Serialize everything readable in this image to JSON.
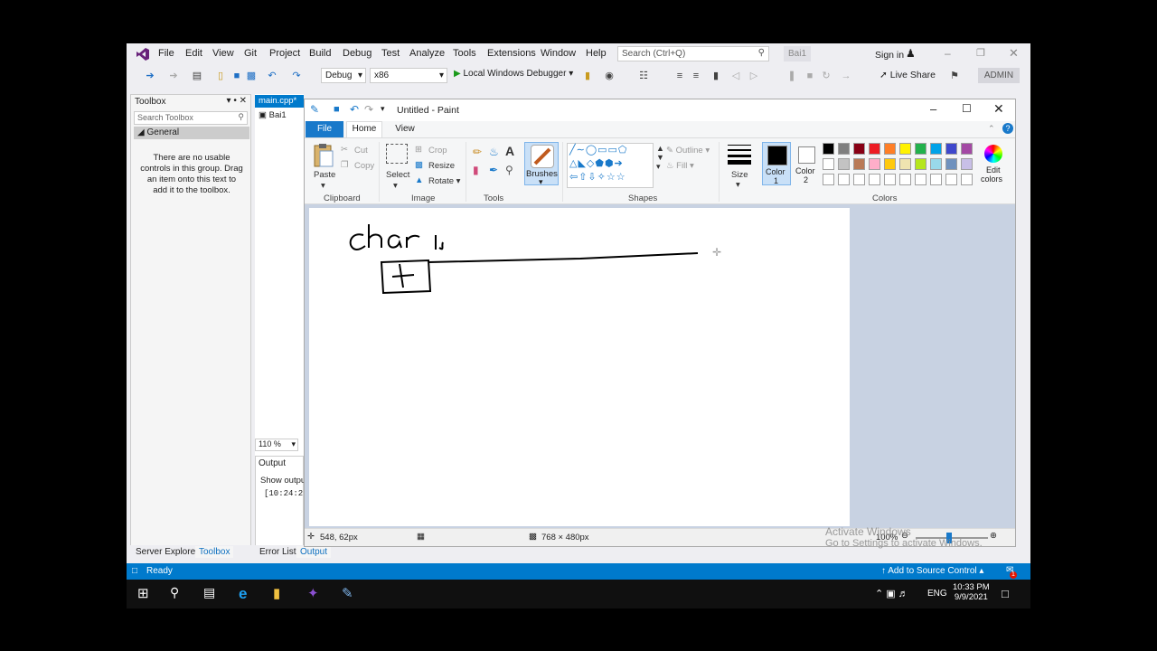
{
  "vs": {
    "menu": [
      "File",
      "Edit",
      "View",
      "Git",
      "Project",
      "Build",
      "Debug",
      "Test",
      "Analyze",
      "Tools",
      "Extensions",
      "Window",
      "Help"
    ],
    "search_placeholder": "Search (Ctrl+Q)",
    "solution_name": "Bai1",
    "sign_in": "Sign in",
    "config": "Debug",
    "platform": "x86",
    "run_label": "Local Windows Debugger",
    "live_share": "Live Share",
    "admin": "ADMIN",
    "toolbox_title": "Toolbox",
    "toolbox_search": "Search Toolbox",
    "toolbox_group": "General",
    "toolbox_empty": "There are no usable controls in this group. Drag an item onto this text to add it to the toolbox.",
    "doc_tab": "main.cpp*",
    "doc_scope": "Bai1",
    "zoom": "110 %",
    "output_title": "Output",
    "output_show": "Show output",
    "output_line": "[10:24:2",
    "bottom_left_tabs": [
      "Server Explorer",
      "Toolbox"
    ],
    "bottom_right_tabs": [
      "Error List",
      "Output"
    ],
    "status_ready": "Ready",
    "add_source_control": "Add to Source Control",
    "notif_count": "1"
  },
  "paint": {
    "title": "Untitled - Paint",
    "tabs": {
      "file": "File",
      "home": "Home",
      "view": "View"
    },
    "clipboard": {
      "paste": "Paste",
      "cut": "Cut",
      "copy": "Copy",
      "label": "Clipboard"
    },
    "image": {
      "select": "Select",
      "crop": "Crop",
      "resize": "Resize",
      "rotate": "Rotate",
      "label": "Image"
    },
    "tools_label": "Tools",
    "brushes": "Brushes",
    "shapes": {
      "outline": "Outline",
      "fill": "Fill",
      "label": "Shapes"
    },
    "size": "Size",
    "color1": [
      "Color",
      "1"
    ],
    "color2": [
      "Color",
      "2"
    ],
    "edit_colors": [
      "Edit",
      "colors"
    ],
    "colors_label": "Colors",
    "palette_row1": [
      "#000000",
      "#7f7f7f",
      "#880015",
      "#ed1c24",
      "#ff7f27",
      "#fff200",
      "#22b14c",
      "#00a2e8",
      "#3f48cc",
      "#a349a4"
    ],
    "palette_row2": [
      "#ffffff",
      "#c3c3c3",
      "#b97a57",
      "#ffaec9",
      "#ffc90e",
      "#efe4b0",
      "#b5e61d",
      "#99d9ea",
      "#7092be",
      "#c8bfe7"
    ],
    "status_pos": "548, 62px",
    "status_size": "768 × 480px",
    "status_zoom": "100%",
    "canvas_text": "char",
    "canvas_sub": "k"
  },
  "watermark": {
    "line1": "Activate Windows",
    "line2": "Go to Settings to activate Windows."
  },
  "taskbar": {
    "lang": "ENG",
    "time": "10:33 PM",
    "date": "9/9/2021"
  }
}
